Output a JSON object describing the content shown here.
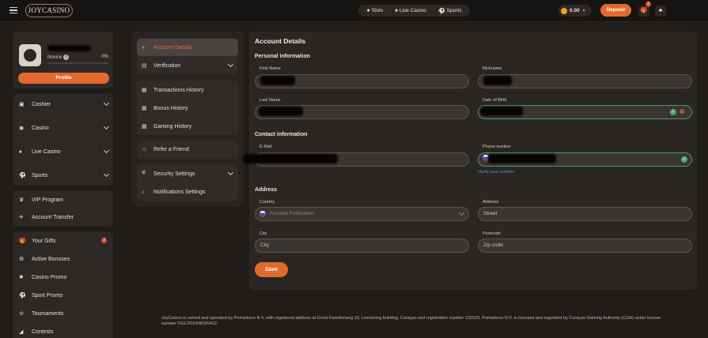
{
  "header": {
    "logo": "JOYCASINO",
    "nav": [
      {
        "label": "Slots",
        "icon": "slots-icon"
      },
      {
        "label": "Live Casino",
        "icon": "live-casino-icon"
      },
      {
        "label": "Sports",
        "icon": "sports-icon"
      }
    ],
    "balance": "0.00",
    "deposit_label": "Deposit",
    "gift_count": "3"
  },
  "profile": {
    "level": "Novice",
    "progress_percent": "0%",
    "progress_value": 0,
    "button_label": "Profile"
  },
  "sidebar": {
    "groups": [
      [
        {
          "label": "Cashier",
          "icon": "wallet-icon",
          "expandable": true
        },
        {
          "label": "Casino",
          "icon": "casino-icon",
          "expandable": true
        },
        {
          "label": "Live Casino",
          "icon": "live-casino-icon",
          "expandable": true
        },
        {
          "label": "Sports",
          "icon": "sports-icon",
          "expandable": true
        }
      ],
      [
        {
          "label": "VIP Program",
          "icon": "crown-icon"
        },
        {
          "label": "Account Transfer",
          "icon": "plane-icon"
        }
      ],
      [
        {
          "label": "Your Gifts",
          "icon": "gift-icon",
          "badge": "3"
        },
        {
          "label": "Active Bonuses",
          "icon": "percent-icon"
        },
        {
          "label": "Casino Promo",
          "icon": "promo-icon"
        },
        {
          "label": "Sport Promo",
          "icon": "ball-icon"
        },
        {
          "label": "Tournaments",
          "icon": "trophy-icon"
        },
        {
          "label": "Contests",
          "icon": "contest-icon"
        }
      ]
    ]
  },
  "account_menu": {
    "account_details": "Account Details",
    "verification": "Verification",
    "transactions_history": "Transactions History",
    "bonus_history": "Bonus History",
    "gaming_history": "Gaming History",
    "refer_friend": "Refer a Friend",
    "security_settings": "Security Settings",
    "notifications_settings": "Notifications Settings"
  },
  "main": {
    "title": "Account Details",
    "personal": {
      "heading": "Personal information",
      "first_name_label": "First Name",
      "nickname_label": "Nickname",
      "last_name_label": "Last Name",
      "dob_label": "Date of Birth"
    },
    "contact": {
      "heading": "Contact information",
      "email_label": "E-Mail",
      "phone_label": "Phone number",
      "verify_link": "Verify your number"
    },
    "address": {
      "heading": "Address",
      "country_label": "Country",
      "country_value": "Russian Federation",
      "address_label": "Address",
      "address_placeholder": "Street",
      "city_label": "City",
      "city_placeholder": "City",
      "postcode_label": "Postcode",
      "postcode_placeholder": "Zip code"
    },
    "save_label": "Save"
  },
  "footer": {
    "text": "JoyCasino is owned and operated by Pomadorro N.V. with registered address at Groot Kwartierweg 10, Livestrong building, Curaçao and registration number 131629. Pomadorro N.V. is licensed and regulated by Curaçao Gaming Authority (CGA) under license number OGL/2024/863/0412."
  }
}
